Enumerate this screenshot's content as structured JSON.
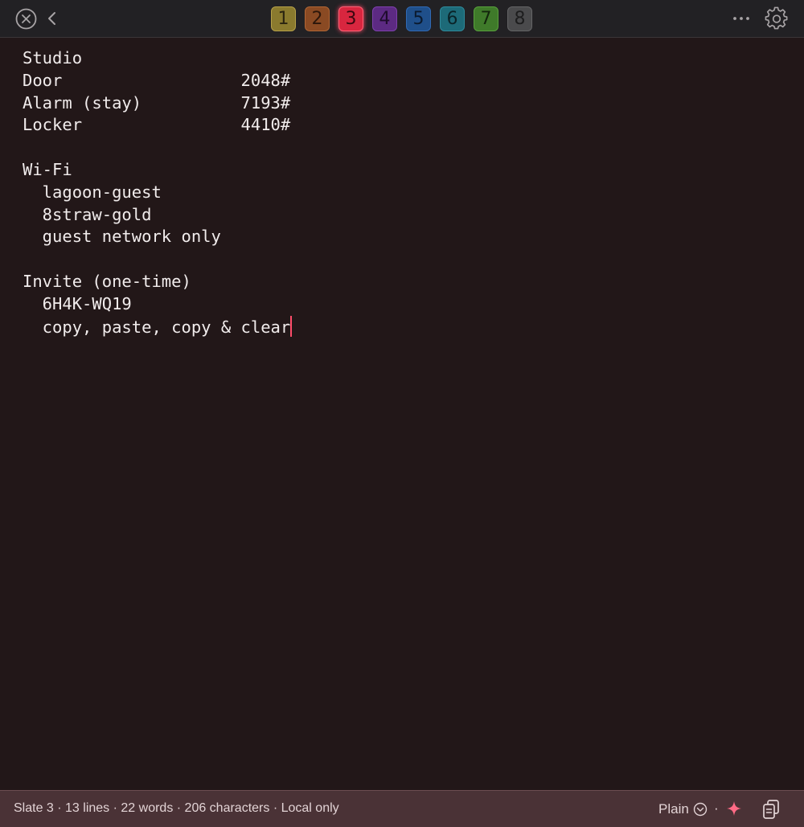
{
  "slots": [
    {
      "label": "1",
      "bg": "#8a7a2e",
      "fg": "#2a2410",
      "border": "#b5a048"
    },
    {
      "label": "2",
      "bg": "#8a4a23",
      "fg": "#2c170b",
      "border": "#b06534"
    },
    {
      "label": "3",
      "bg": "#d8263f",
      "fg": "#3a0710",
      "border": "#ff6074",
      "active": true
    },
    {
      "label": "4",
      "bg": "#5c2a82",
      "fg": "#1e0c2c",
      "border": "#7e40ad"
    },
    {
      "label": "5",
      "bg": "#1f4f8a",
      "fg": "#0b1a2e",
      "border": "#3069b4"
    },
    {
      "label": "6",
      "bg": "#1d6a78",
      "fg": "#0a2328",
      "border": "#2e8a9a"
    },
    {
      "label": "7",
      "bg": "#3f7a2a",
      "fg": "#13260c",
      "border": "#58a03c"
    },
    {
      "label": "8",
      "bg": "#4a4a4c",
      "fg": "#1d1d1e",
      "border": "#646466"
    }
  ],
  "editor": {
    "lines": [
      "Studio",
      "Door                  2048#",
      "Alarm (stay)          7193#",
      "Locker                4410#",
      "",
      "Wi-Fi",
      "  lagoon-guest",
      "  8straw-gold",
      "  guest network only",
      "",
      "Invite (one-time)",
      "  6H4K-WQ19",
      "  copy, paste, copy & clear"
    ]
  },
  "status": {
    "text": "Slate 3 · 13 lines · 22 words · 206 characters · Local only",
    "mode": "Plain",
    "separator": "·"
  },
  "colors": {
    "accent": "#ff4d6a",
    "background": "#221718",
    "statusbar": "#4a3236"
  },
  "icons": {
    "close": "close-circle-icon",
    "back": "chevron-left-icon",
    "more": "ellipsis-icon",
    "settings": "gear-icon",
    "mode_dropdown": "chevron-down-circle-icon",
    "ai": "sparkle-icon",
    "copy": "copy-icon"
  }
}
